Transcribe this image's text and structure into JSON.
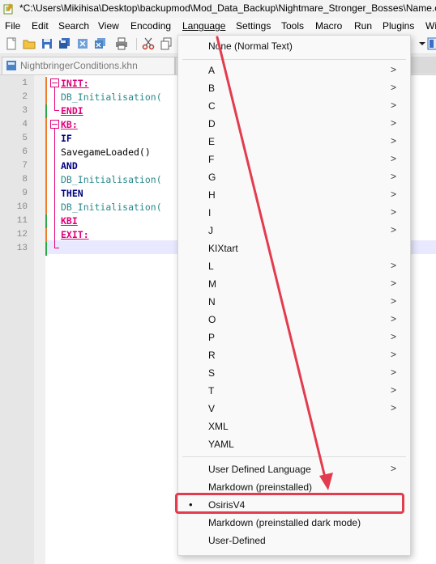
{
  "window": {
    "title": "*C:\\Users\\Mikihisa\\Desktop\\backupmod\\Mod_Data_Backup\\Nightmare_Stronger_Bosses\\Name.os"
  },
  "menubar": {
    "items": [
      "File",
      "Edit",
      "Search",
      "View",
      "Encoding",
      "Language",
      "Settings",
      "Tools",
      "Macro",
      "Run",
      "Plugins",
      "Wi"
    ]
  },
  "tabs": {
    "active": "NightbringerConditions.khn"
  },
  "editor": {
    "line_numbers": [
      "1",
      "2",
      "3",
      "4",
      "5",
      "6",
      "7",
      "8",
      "9",
      "10",
      "11",
      "12",
      "13"
    ],
    "lines": [
      {
        "text": "INIT:",
        "style": "kw-pink"
      },
      {
        "text": "DB_Initialisation(",
        "style": "fn-teal"
      },
      {
        "text": "ENDI",
        "style": "kw-pink"
      },
      {
        "text": "KB:",
        "style": "kw-pink"
      },
      {
        "text": "IF",
        "style": "kw-dark"
      },
      {
        "text": "SavegameLoaded()",
        "style": "plain"
      },
      {
        "text": "AND",
        "style": "kw-dark"
      },
      {
        "text": "DB_Initialisation(",
        "style": "fn-teal"
      },
      {
        "text": "THEN",
        "style": "kw-dark"
      },
      {
        "text": "DB_Initialisation(",
        "style": "fn-teal"
      },
      {
        "text": "KBI",
        "style": "kw-pink"
      },
      {
        "text": "EXIT:",
        "style": "kw-pink"
      },
      {
        "text": "",
        "style": "plain"
      }
    ]
  },
  "language_menu": {
    "top_item": "None (Normal Text)",
    "letters": [
      "A",
      "B",
      "C",
      "D",
      "E",
      "F",
      "G",
      "H",
      "I",
      "J",
      "KIXtart",
      "L",
      "M",
      "N",
      "O",
      "P",
      "R",
      "S",
      "T",
      "V",
      "XML",
      "YAML"
    ],
    "letters_with_submenu": [
      "A",
      "B",
      "C",
      "D",
      "E",
      "F",
      "G",
      "H",
      "I",
      "J",
      "L",
      "M",
      "N",
      "O",
      "P",
      "R",
      "S",
      "T",
      "V"
    ],
    "user_defined_language": "User Defined Language",
    "markdown": "Markdown (preinstalled)",
    "selected": "OsirisV4",
    "markdown_dark": "Markdown (preinstalled dark mode)",
    "user_defined": "User-Defined",
    "bullet": "•",
    "submenu_arrow": ">"
  },
  "annotation": {
    "color": "#e23c4e"
  }
}
